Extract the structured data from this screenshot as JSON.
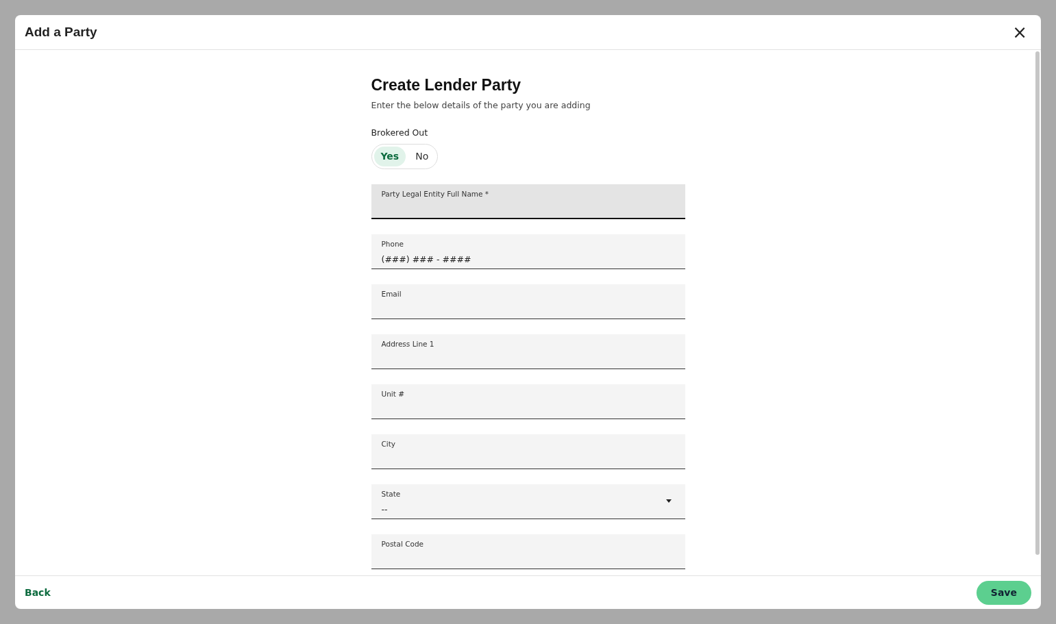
{
  "modal": {
    "title": "Add a Party",
    "close": "×"
  },
  "form": {
    "heading": "Create Lender Party",
    "subheading": "Enter the below details of the party you are adding",
    "toggle": {
      "label": "Brokered Out",
      "options": [
        {
          "label": "Yes",
          "selected": true
        },
        {
          "label": "No",
          "selected": false
        }
      ]
    },
    "fields": [
      {
        "kind": "text",
        "label": "Party Legal Entity Full Name *",
        "focused": true
      },
      {
        "kind": "text",
        "label": "Phone",
        "placeholder": "(###) ### - ####",
        "focused": false
      },
      {
        "kind": "text",
        "label": "Email",
        "focused": false
      },
      {
        "kind": "text",
        "label": "Address Line 1",
        "focused": false
      },
      {
        "kind": "text",
        "label": "Unit #",
        "focused": false
      },
      {
        "kind": "text",
        "label": "City",
        "focused": false
      },
      {
        "kind": "select",
        "label": "State",
        "value": "--",
        "focused": false
      },
      {
        "kind": "text",
        "label": "Postal Code",
        "focused": false
      }
    ]
  },
  "footer": {
    "back": "Back",
    "save": "Save"
  }
}
